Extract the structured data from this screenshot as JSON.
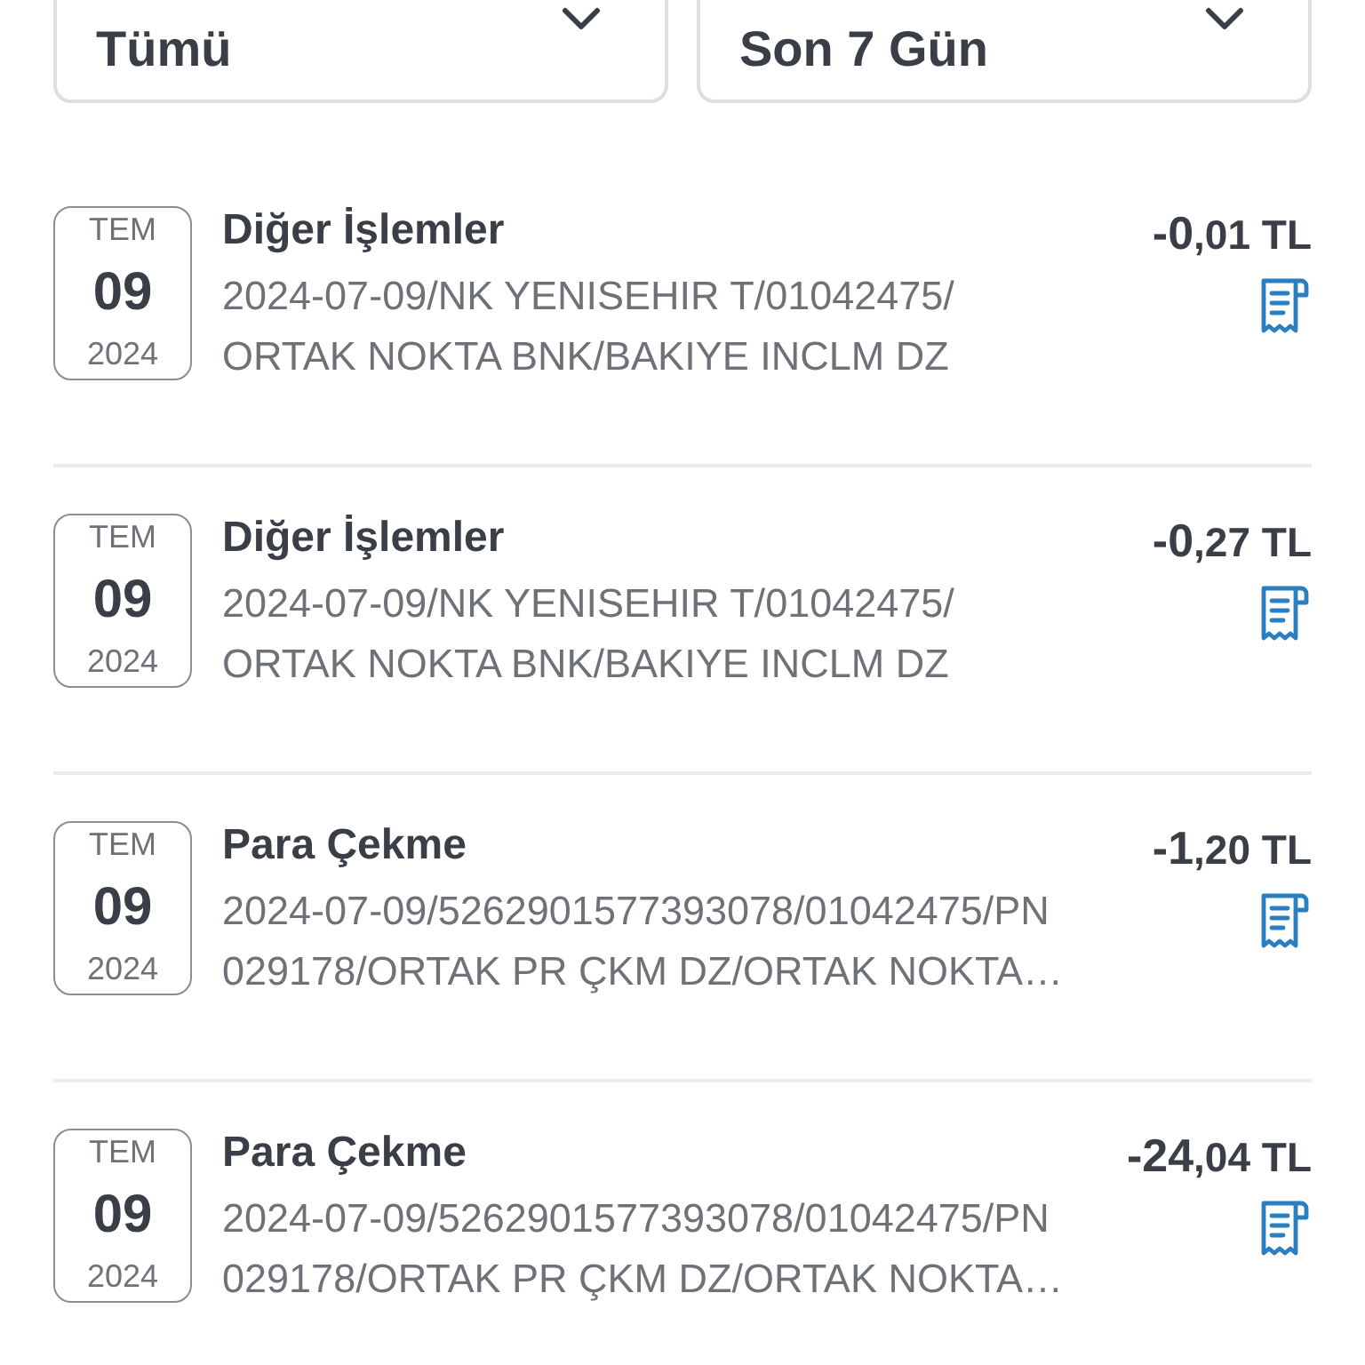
{
  "filters": [
    {
      "value": "Tümü"
    },
    {
      "value": "Son 7 Gün"
    }
  ],
  "transactions": [
    {
      "month": "TEM",
      "day": "09",
      "year": "2024",
      "title": "Diğer İşlemler",
      "description": [
        "2024-07-09/NK YENISEHIR T/01042475/",
        "ORTAK NOKTA BNK/BAKIYE INCLM DZ"
      ],
      "amount": "**-0**,01 TL"
    },
    {
      "month": "TEM",
      "day": "09",
      "year": "2024",
      "title": "Diğer İşlemler",
      "description": [
        "2024-07-09/NK YENISEHIR T/01042475/",
        "ORTAK NOKTA BNK/BAKIYE INCLM DZ"
      ],
      "amount": "**-0**,27 TL"
    },
    {
      "month": "TEM",
      "day": "09",
      "year": "2024",
      "title": "Para Çekme",
      "description": [
        "2024-07-09/5262901577393078/01042475/PN",
        "029178/ORTAK PR ÇKM DZ/ORTAK NOKTA…"
      ],
      "amount": "**-1**,20 TL"
    },
    {
      "month": "TEM",
      "day": "09",
      "year": "2024",
      "title": "Para Çekme",
      "description": [
        "2024-07-09/5262901577393078/01042475/PN",
        "029178/ORTAK PR ÇKM DZ/ORTAK NOKTA…"
      ],
      "amount": "**-24**,04 TL"
    }
  ]
}
